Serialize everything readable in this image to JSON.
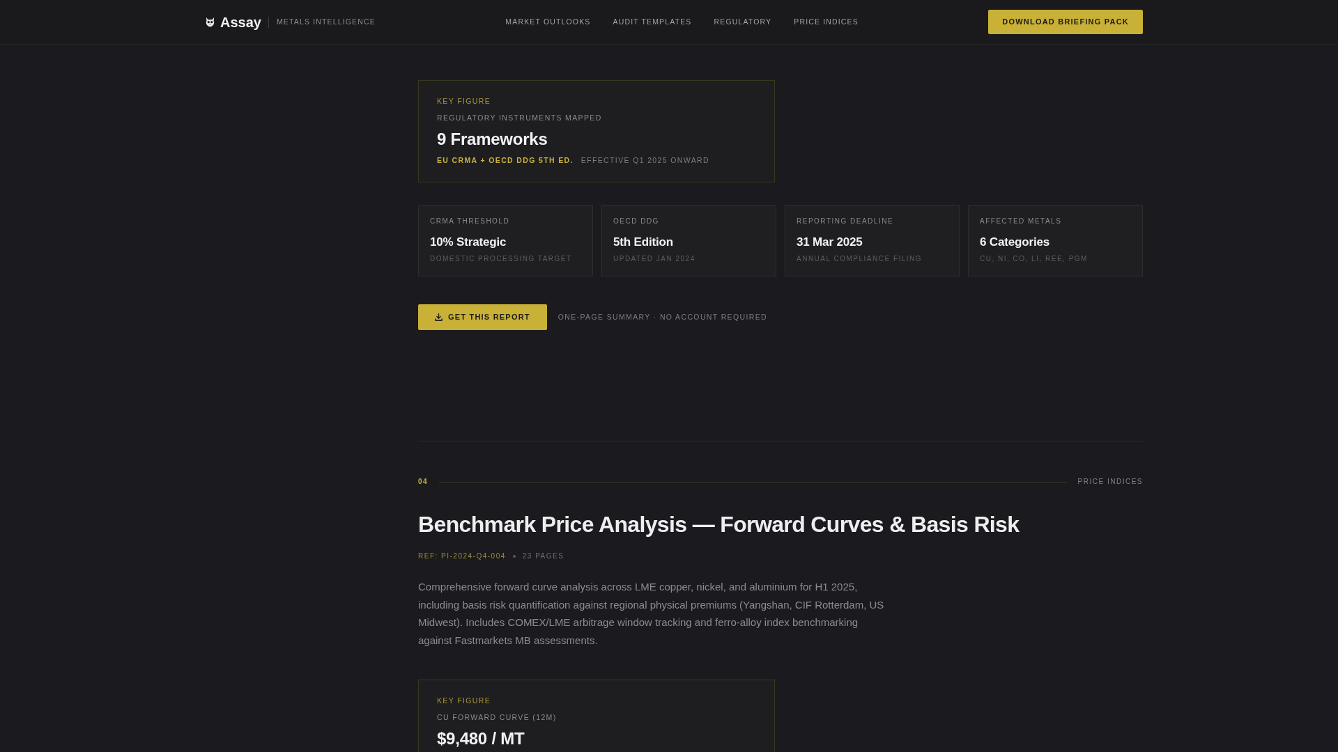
{
  "header": {
    "brand": "Assay",
    "tagline": "METALS INTELLIGENCE",
    "nav": [
      "MARKET OUTLOOKS",
      "AUDIT TEMPLATES",
      "REGULATORY",
      "PRICE INDICES"
    ],
    "cta": "DOWNLOAD BRIEFING PACK"
  },
  "key_figure": {
    "eyebrow": "KEY FIGURE",
    "label": "REGULATORY INSTRUMENTS MAPPED",
    "value": "9 Frameworks",
    "highlight": "EU CRMA + OECD DDG 5TH ED.",
    "note": "EFFECTIVE Q1 2025 ONWARD"
  },
  "stats": [
    {
      "label": "CRMA THRESHOLD",
      "value": "10% Strategic",
      "note": "DOMESTIC PROCESSING TARGET"
    },
    {
      "label": "OECD DDG",
      "value": "5th Edition",
      "note": "UPDATED JAN 2024"
    },
    {
      "label": "REPORTING DEADLINE",
      "value": "31 Mar 2025",
      "note": "ANNUAL COMPLIANCE FILING"
    },
    {
      "label": "AFFECTED METALS",
      "value": "6 Categories",
      "note": "CU, NI, CO, LI, REE, PGM"
    }
  ],
  "report_action": {
    "button": "GET THIS REPORT",
    "note": "ONE-PAGE SUMMARY · NO ACCOUNT REQUIRED"
  },
  "section": {
    "number": "04",
    "category": "PRICE INDICES",
    "title": "Benchmark Price Analysis — Forward Curves & Basis Risk",
    "ref": "REF: PI-2024-Q4-004",
    "pages": "23 PAGES",
    "description": "Comprehensive forward curve analysis across LME copper, nickel, and aluminium for H1 2025, including basis risk quantification against regional physical premiums (Yangshan, CIF Rotterdam, US Midwest). Includes COMEX/LME arbitrage window tracking and ferro-alloy index benchmarking against Fastmarkets MB assessments.",
    "key_figure": {
      "eyebrow": "KEY FIGURE",
      "label": "CU FORWARD CURVE (12M)",
      "value": "$9,480 / MT"
    }
  }
}
